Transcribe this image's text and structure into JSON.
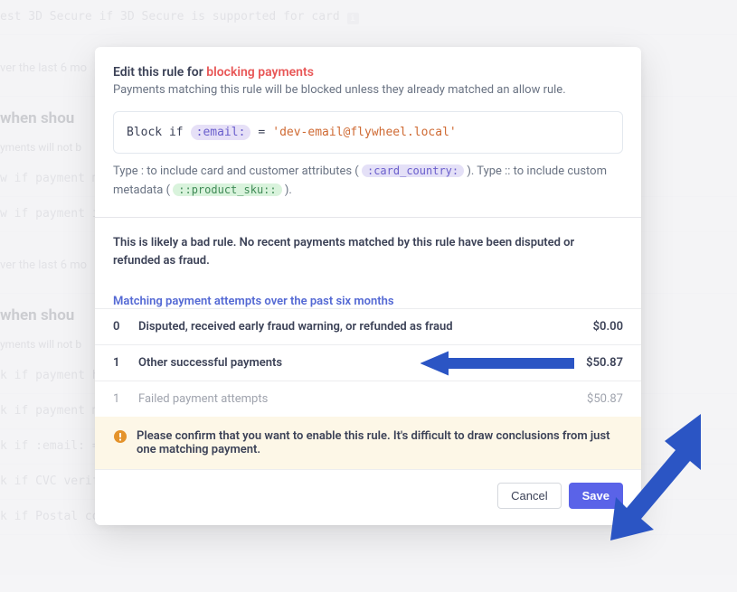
{
  "bg": {
    "line0": "est 3D Secure if   3D Secure is supported for card",
    "group1": "ver the last 6 mo",
    "heading1": "when shou",
    "sub1": "yments will not b",
    "line_w_if_pm": "w if   payment m",
    "line_w_if_pi": "w if   payment i",
    "group2": "ver the last 6 mo",
    "heading2": "when shou",
    "sub2": "yments will not b",
    "line_k_if_ph": "k if   payment h",
    "line_k_if_pm": "k if   payment m",
    "line_k_if_email": "k if   :email: =",
    "line_k_if_cvc": "k if   CVC verif",
    "line_k_if_postal": "k if   Postal code verification fails"
  },
  "modal": {
    "title_prefix": "Edit this rule for ",
    "title_highlight": "blocking payments",
    "desc": "Payments matching this rule will be blocked unless they already matched an allow rule.",
    "rule": {
      "keyword": "Block if",
      "attr_pill": ":email:",
      "equals": "=",
      "value": "'dev-email@flywheel.local'"
    },
    "hint_parts": {
      "p1": "Type : to include card and customer attributes ( ",
      "card_pill": ":card_country:",
      "p2": " ). Type :: to include custom metadata ( ",
      "sku_pill": "::product_sku::",
      "p3": " )."
    },
    "bad_rule": "This is likely a bad rule. No recent payments matched by this rule have been disputed or refunded as fraud.",
    "match_title": "Matching payment attempts over the past six months",
    "rows": [
      {
        "count": "0",
        "label": "Disputed, received early fraud warning, or refunded as fraud",
        "amount": "$0.00"
      },
      {
        "count": "1",
        "label": "Other successful payments",
        "amount": "$50.87"
      },
      {
        "count": "1",
        "label": "Failed payment attempts",
        "amount": "$50.87"
      }
    ],
    "confirm_text": "Please confirm that you want to enable this rule. It's difficult to draw conclusions from just one matching payment.",
    "cancel": "Cancel",
    "save": "Save"
  },
  "colors": {
    "accent": "#5a63e8",
    "danger": "#e85757",
    "arrow": "#2b55c4"
  }
}
